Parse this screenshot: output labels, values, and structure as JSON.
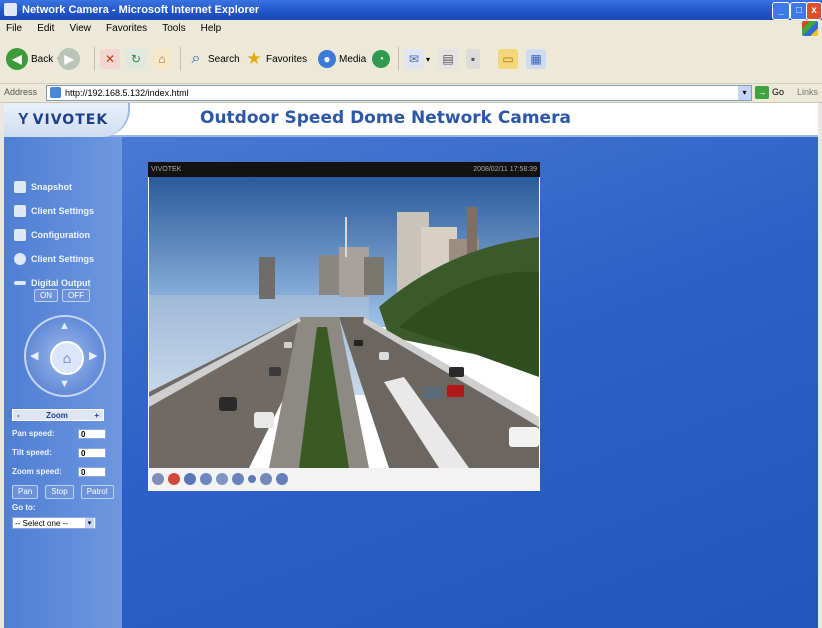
{
  "window": {
    "title": "Network Camera - Microsoft Internet Explorer",
    "min_glyph": "_",
    "max_glyph": "□",
    "close_glyph": "x"
  },
  "menubar": [
    "File",
    "Edit",
    "View",
    "Favorites",
    "Tools",
    "Help"
  ],
  "toolbar": {
    "back_label": "Back",
    "search_label": "Search",
    "favorites_label": "Favorites",
    "media_label": "Media"
  },
  "addressbar": {
    "label": "Address",
    "url": "http://192.168.5.132/index.html",
    "go_label": "Go",
    "links_label": "Links"
  },
  "page": {
    "logo_mark": "Y",
    "logo_text": "VIVOTEK",
    "title": "Outdoor Speed Dome Network Camera"
  },
  "sidebar": {
    "nav": [
      {
        "label": "Snapshot"
      },
      {
        "label": "Client Settings"
      },
      {
        "label": "Configuration"
      },
      {
        "label": "Client Settings"
      },
      {
        "label": "Digital Output"
      }
    ],
    "digital_output": {
      "on": "ON",
      "off": "OFF"
    },
    "ptz": {
      "home_glyph": "⌂"
    },
    "zoom": {
      "minus": "-",
      "label": "Zoom",
      "plus": "+"
    },
    "speeds": [
      {
        "label": "Pan speed:",
        "value": "0"
      },
      {
        "label": "Tilt speed:",
        "value": "0"
      },
      {
        "label": "Zoom speed:",
        "value": "0"
      }
    ],
    "patrol_buttons": {
      "pan": "Pan",
      "stop": "Stop",
      "patrol": "Patrol"
    },
    "goto_label": "Go to:",
    "preset_value": "-- Select one --"
  },
  "video": {
    "caption_left": "VIVOTEK",
    "caption_right": "2008/02/11 17:58:39"
  },
  "colors": {
    "title_blue": "#2b57a8",
    "page_bg": "#2c5cc0",
    "ie_title": "#1f55c8"
  }
}
